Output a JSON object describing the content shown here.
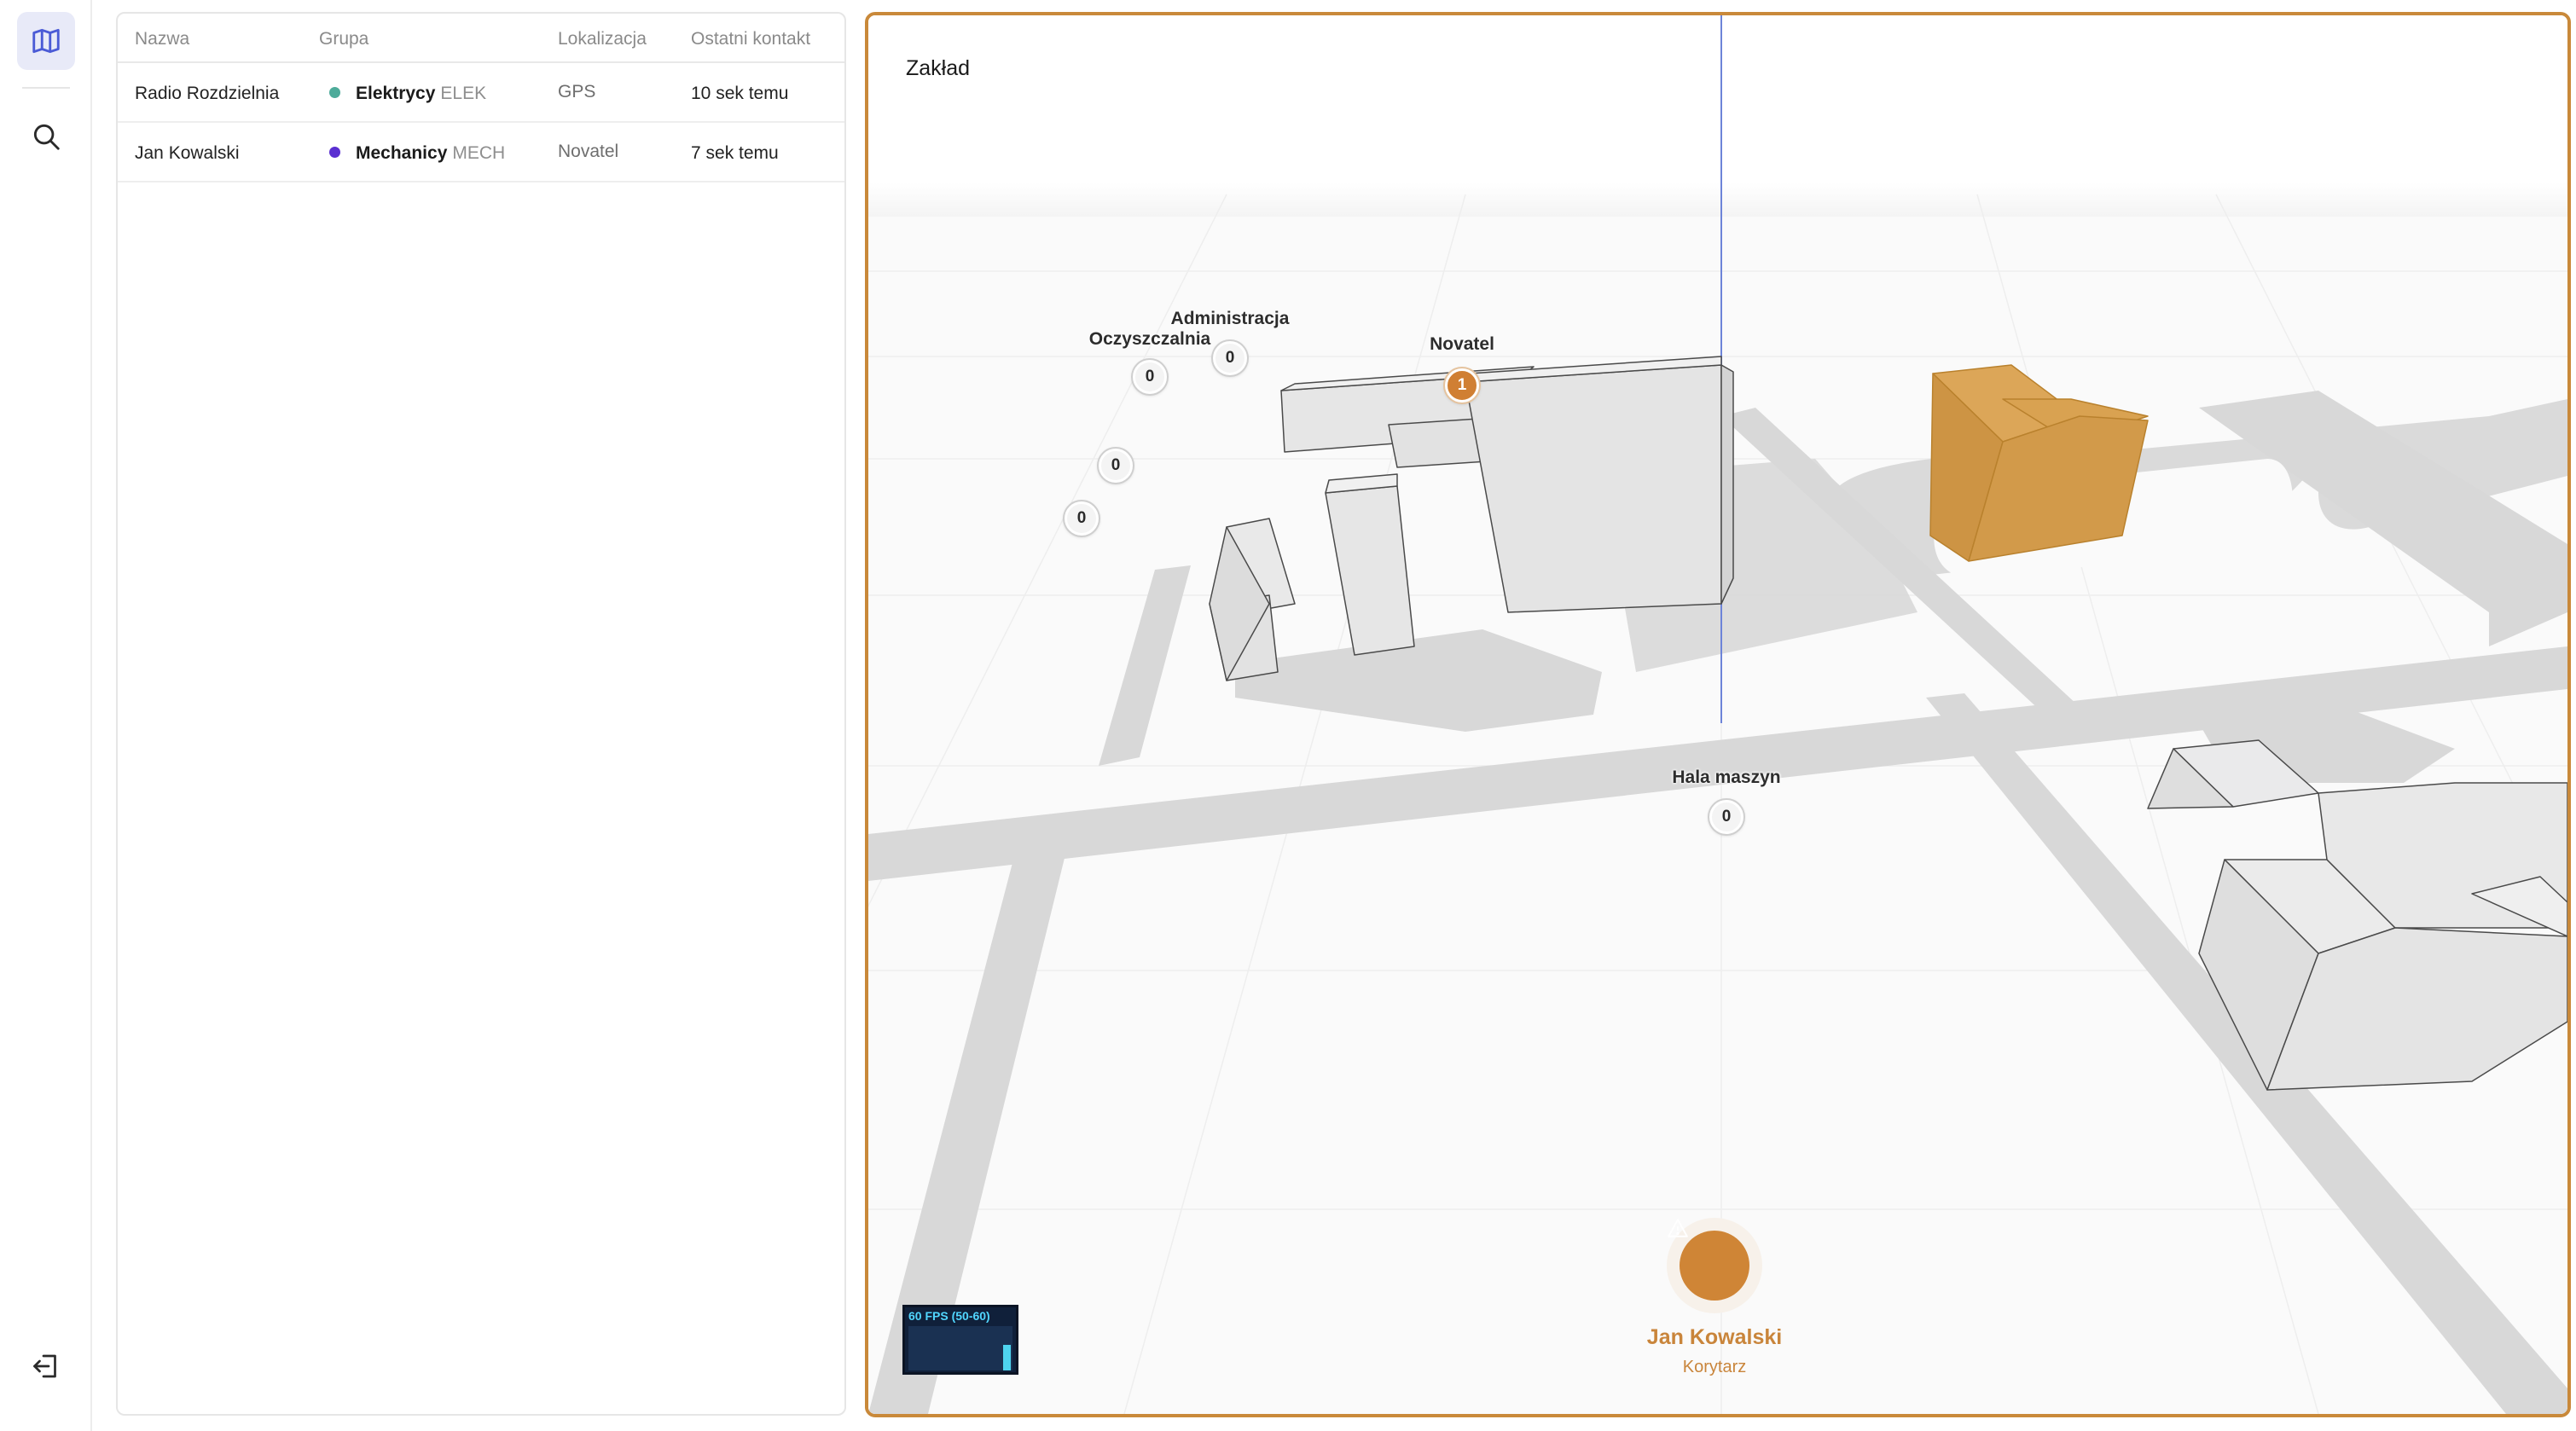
{
  "colors": {
    "accent": "#c9893a",
    "map_border": "#c9893a",
    "highlight_building": "#d29d4a",
    "road": "#d6d6d6",
    "building": "#e4e4e4",
    "elektrycy_dot": "#4dab9a",
    "mechanicy_dot": "#5a2fd1"
  },
  "rail": {
    "items": [
      {
        "icon": "map-icon",
        "active": true
      },
      {
        "icon": "search-icon",
        "active": false
      }
    ],
    "bottom_icon": "logout-icon"
  },
  "table": {
    "headers": [
      "Nazwa",
      "Grupa",
      "Lokalizacja",
      "Ostatni kontakt"
    ],
    "rows": [
      {
        "name": "Radio Rozdzielnia",
        "group_name": "Elektrycy",
        "group_code": "ELEK",
        "group_color": "#4dab9a",
        "location": "GPS",
        "last_contact": "10 sek temu"
      },
      {
        "name": "Jan Kowalski",
        "group_name": "Mechanicy",
        "group_code": "MECH",
        "group_color": "#5a2fd1",
        "location": "Novatel",
        "last_contact": "7 sek temu"
      }
    ]
  },
  "map": {
    "title": "Zakład",
    "buildings": [
      {
        "label": "Oczyszczalnia",
        "count": "0"
      },
      {
        "label": "Administracja",
        "count": "0"
      },
      {
        "label": "Novatel",
        "count": "1",
        "highlighted": true
      },
      {
        "label": "Hala maszyn",
        "count": "0"
      }
    ],
    "unlabeled_counts": [
      "0",
      "0"
    ],
    "fps": "60 FPS (50-60)",
    "person": {
      "name": "Jan Kowalski",
      "location": "Korytarz",
      "icon": "warning-icon"
    }
  }
}
